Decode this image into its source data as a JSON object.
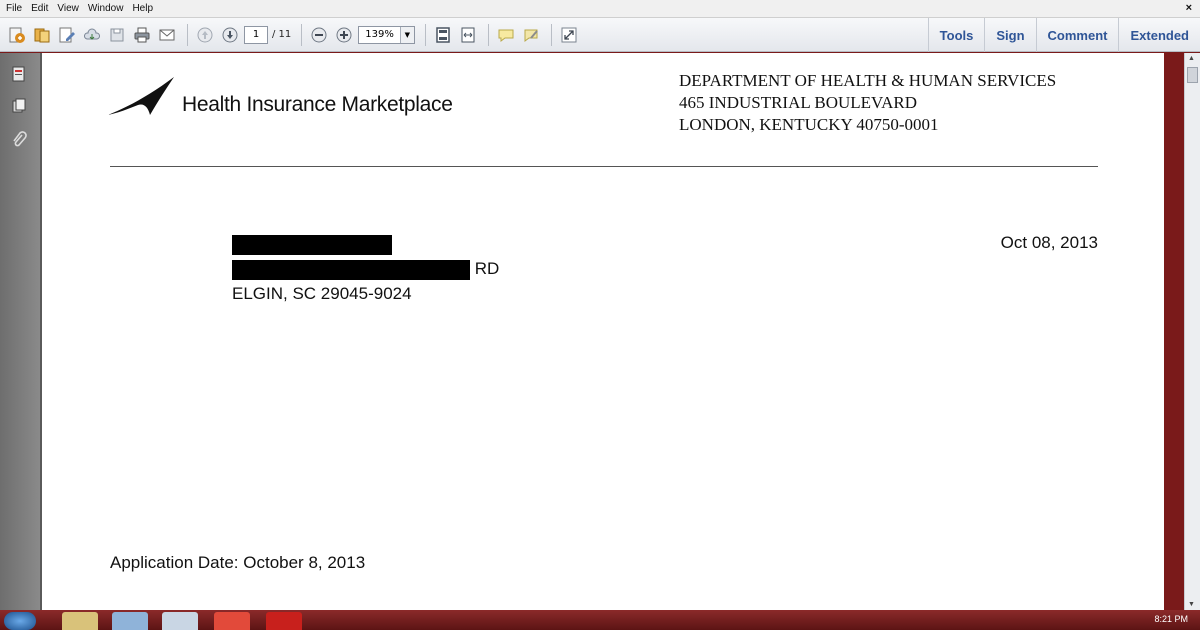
{
  "menu": {
    "items": [
      "File",
      "Edit",
      "View",
      "Window",
      "Help"
    ],
    "close": "×"
  },
  "toolbar": {
    "current_page": "1",
    "total_pages": "/ 11",
    "zoom": "139%",
    "right": [
      "Tools",
      "Sign",
      "Comment",
      "Extended"
    ]
  },
  "document": {
    "logo_text": "Health Insurance Marketplace",
    "department": [
      "DEPARTMENT OF HEALTH & HUMAN SERVICES",
      "465 INDUSTRIAL BOULEVARD",
      "LONDON, KENTUCKY 40750-0001"
    ],
    "address_street_suffix": "RD",
    "address_city": "ELGIN, SC 29045-9024",
    "letter_date": "Oct 08, 2013",
    "application_date": "Application Date: October 8, 2013"
  },
  "taskbar": {
    "clock": "8:21 PM"
  },
  "colors": {
    "accent": "#2f5597",
    "taskbar": "#7a1a1a"
  }
}
